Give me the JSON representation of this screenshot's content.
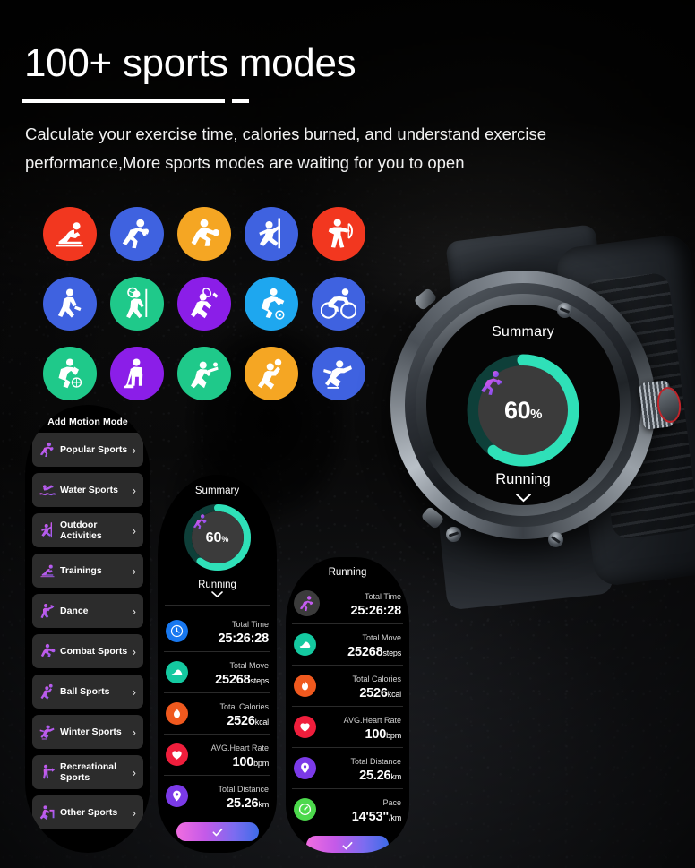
{
  "hero": {
    "title": "100+ sports modes",
    "subtitle": "Calculate your exercise time, calories burned, and understand exercise performance,More sports modes are waiting for you to open"
  },
  "sports_grid": [
    {
      "name": "rowing",
      "color": "#f2371f"
    },
    {
      "name": "football",
      "color": "#3f62e0"
    },
    {
      "name": "boxing",
      "color": "#f5a623"
    },
    {
      "name": "climbing",
      "color": "#3f62e0"
    },
    {
      "name": "archery",
      "color": "#f2371f"
    },
    {
      "name": "walking",
      "color": "#3f62e0"
    },
    {
      "name": "golf-hiking",
      "color": "#1fc98a"
    },
    {
      "name": "badminton",
      "color": "#8b1ee8"
    },
    {
      "name": "soccer",
      "color": "#1ea7ef"
    },
    {
      "name": "cycling",
      "color": "#3f62e0"
    },
    {
      "name": "basketball",
      "color": "#1fc98a"
    },
    {
      "name": "hockey",
      "color": "#8b1ee8"
    },
    {
      "name": "baseball",
      "color": "#1fc98a"
    },
    {
      "name": "volleyball",
      "color": "#f5a623"
    },
    {
      "name": "skating",
      "color": "#3f62e0"
    }
  ],
  "sidebar": {
    "title": "Add Motion Mode",
    "items": [
      {
        "label": "Popular Sports",
        "icon": "runner-icon",
        "arrow": "›"
      },
      {
        "label": "Water Sports",
        "icon": "swimmer-icon",
        "arrow": "›"
      },
      {
        "label": "Outdoor Activities",
        "icon": "climber-icon",
        "arrow": "›"
      },
      {
        "label": "Trainings",
        "icon": "rowing-icon",
        "arrow": "›"
      },
      {
        "label": "Dance",
        "icon": "dancer-icon",
        "arrow": "›"
      },
      {
        "label": "Combat Sports",
        "icon": "boxer-icon",
        "arrow": "›"
      },
      {
        "label": "Ball Sports",
        "icon": "volleyball-icon",
        "arrow": "›"
      },
      {
        "label": "Winter Sports",
        "icon": "skater-icon",
        "arrow": "›"
      },
      {
        "label": "Recreational Sports",
        "icon": "frisbee-icon",
        "arrow": "›"
      },
      {
        "label": "Other Sports",
        "icon": "stepper-icon",
        "arrow": "›"
      }
    ]
  },
  "watch": {
    "screen_title": "Summary",
    "percent": "60",
    "percent_unit": "%",
    "mode": "Running",
    "chevron": "⌄",
    "ring_progress": 60,
    "ring_color": "#2fe0b8",
    "ring_track": "#0d3c36",
    "activity_icon": "runner-icon"
  },
  "summary_card": {
    "title": "Summary",
    "percent": "60",
    "percent_unit": "%",
    "mode": "Running",
    "chevron": "⌄",
    "ring_progress": 60,
    "confirm_icon": "check-icon",
    "stats": [
      {
        "label": "Total Time",
        "value": "25:26:28",
        "unit": "",
        "icon": "clock-icon",
        "color": "#1878f0"
      },
      {
        "label": "Total Move",
        "value": "25268",
        "unit": "steps",
        "icon": "shoe-icon",
        "color": "#14c9a0"
      },
      {
        "label": "Total Calories",
        "value": "2526",
        "unit": "kcal",
        "icon": "flame-icon",
        "color": "#f0591e"
      },
      {
        "label": "AVG.Heart Rate",
        "value": "100",
        "unit": "bpm",
        "icon": "heart-icon",
        "color": "#f01e3c"
      },
      {
        "label": "Total Distance",
        "value": "25.26",
        "unit": "km",
        "icon": "pin-icon",
        "color": "#7b3ae8"
      }
    ]
  },
  "running_card": {
    "title": "Running",
    "activity_icon": "runner-icon",
    "confirm_icon": "check-icon",
    "stats": [
      {
        "label": "Total Time",
        "value": "25:26:28",
        "unit": "",
        "icon": "runner-icon",
        "color": "#3b3b3b"
      },
      {
        "label": "Total Move",
        "value": "25268",
        "unit": "steps",
        "icon": "shoe-icon",
        "color": "#14c9a0"
      },
      {
        "label": "Total Calories",
        "value": "2526",
        "unit": "kcal",
        "icon": "flame-icon",
        "color": "#f0591e"
      },
      {
        "label": "AVG.Heart Rate",
        "value": "100",
        "unit": "bpm",
        "icon": "heart-icon",
        "color": "#f01e3c"
      },
      {
        "label": "Total Distance",
        "value": "25.26",
        "unit": "km",
        "icon": "pin-icon",
        "color": "#7b3ae8"
      },
      {
        "label": "Pace",
        "value": "14'53\"",
        "unit": "/km",
        "icon": "gauge-icon",
        "color": "#4cd94c"
      }
    ]
  },
  "colors": {
    "accent_green": "#2fe0b8",
    "accent_purple": "#c35cf0",
    "button_gradient_start": "#f06de0",
    "button_gradient_end": "#3f6be8"
  }
}
